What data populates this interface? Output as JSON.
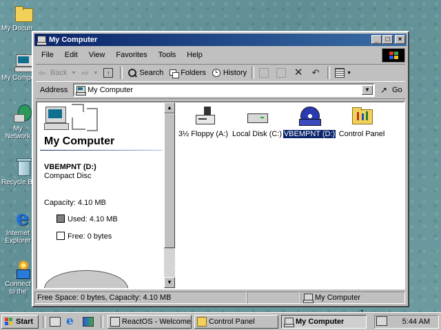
{
  "desktop": {
    "icons": [
      {
        "label": "My Documents"
      },
      {
        "label": "My Computer"
      },
      {
        "label": "My Network Places"
      },
      {
        "label": "Recycle Bin"
      },
      {
        "label": "Internet Explorer"
      },
      {
        "label": "Connect to the Internet"
      }
    ]
  },
  "window": {
    "title": "My Computer",
    "buttons": {
      "minimize": "_",
      "maximize": "□",
      "close": "×"
    }
  },
  "menu": [
    "File",
    "Edit",
    "View",
    "Favorites",
    "Tools",
    "Help"
  ],
  "toolbar": {
    "back": "Back",
    "search": "Search",
    "folders": "Folders",
    "history": "History"
  },
  "address": {
    "label": "Address",
    "value": "My Computer",
    "go": "Go"
  },
  "left_pane": {
    "heading": "My Computer",
    "drive_name": "VBEMPNT (D:)",
    "drive_type": "Compact Disc",
    "capacity": "Capacity: 4.10 MB",
    "used": "Used: 4.10 MB",
    "free": "Free: 0 bytes"
  },
  "files": [
    {
      "label": "3½ Floppy (A:)",
      "icon": "floppy-drive-icon",
      "selected": false
    },
    {
      "label": "Local Disk (C:)",
      "icon": "hard-disk-icon",
      "selected": false
    },
    {
      "label": "VBEMPNT (D:)",
      "icon": "cd-drive-icon",
      "selected": true
    },
    {
      "label": "Control Panel",
      "icon": "control-panel-icon",
      "selected": false
    }
  ],
  "status": {
    "left": "Free Space: 0 bytes, Capacity: 4.10 MB",
    "right": "My Computer"
  },
  "taskbar": {
    "start": "Start",
    "tasks": [
      "ReactOS - Welcome",
      "Control Panel",
      "My Computer"
    ],
    "time": "5:44 AM"
  },
  "colors": {
    "title_bar": "#0a246a",
    "desktop": "#5f8f94",
    "selection": "#0a246a"
  }
}
